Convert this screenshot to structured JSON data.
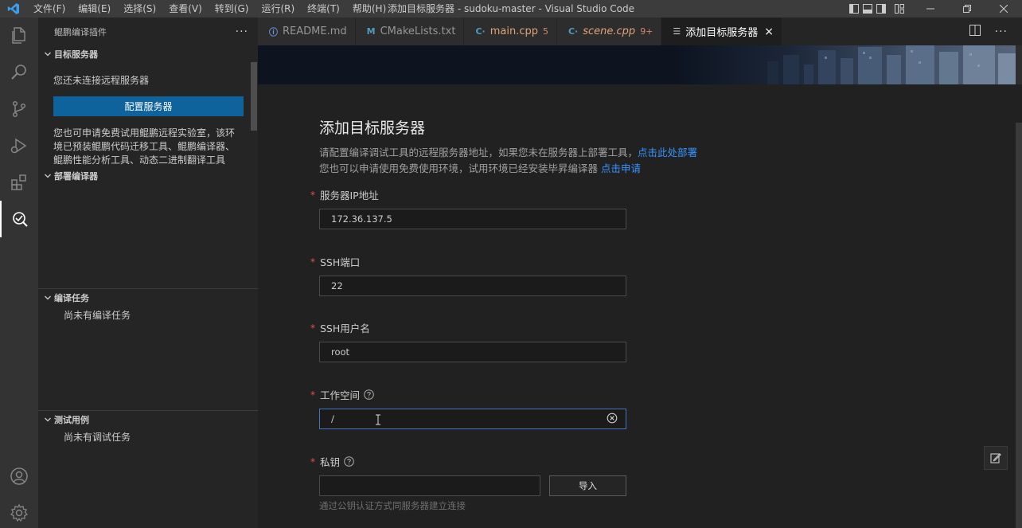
{
  "titlebar": {
    "menu": [
      "文件(F)",
      "编辑(E)",
      "选择(S)",
      "查看(V)",
      "转到(G)",
      "运行(R)",
      "终端(T)",
      "帮助(H)"
    ],
    "window_title": "添加目标服务器 - sudoku-master - Visual Studio Code"
  },
  "activitybar": {
    "icons": [
      "explorer-icon",
      "search-icon",
      "source-control-icon",
      "run-debug-icon",
      "extensions-icon",
      "kunpeng-compiler-icon",
      "account-icon",
      "settings-gear-icon"
    ]
  },
  "sidebar": {
    "title": "鲲鹏编译插件",
    "more": "···",
    "target_server": {
      "header": "目标服务器",
      "status": "您还未连接远程服务器",
      "button": "配置服务器",
      "info_lines": [
        "您也可申请免费试用鲲鹏远程实验室，该环",
        "境已预装鲲鹏代码迁移工具、鲲鹏编译器、",
        "鲲鹏性能分析工具、动态二进制翻译工具"
      ]
    },
    "deploy_compiler": {
      "header": "部署编译器"
    },
    "compile_tasks": {
      "header": "编译任务",
      "empty": "尚未有编译任务"
    },
    "test_cases": {
      "header": "测试用例",
      "empty": "尚未有调试任务"
    }
  },
  "tabs": [
    {
      "label": "README.md",
      "icon": "ⓘ",
      "icon_color": "#6796e6",
      "label_color": "#969696",
      "badge": "",
      "italic": false
    },
    {
      "label": "CMakeLists.txt",
      "icon": "M",
      "icon_color": "#519aba",
      "label_color": "#969696",
      "badge": "",
      "italic": false
    },
    {
      "label": "main.cpp",
      "icon": "C·",
      "icon_color": "#519aba",
      "label_color": "#e2a27a",
      "badge": "5",
      "italic": false
    },
    {
      "label": "scene.cpp",
      "icon": "C·",
      "icon_color": "#519aba",
      "label_color": "#e2a27a",
      "badge": "9+",
      "italic": true
    },
    {
      "label": "添加目标服务器",
      "icon": "☰",
      "icon_color": "#cccccc",
      "label_color": "#ffffff",
      "badge": "",
      "italic": false,
      "active": true,
      "close": "×"
    }
  ],
  "form": {
    "title": "添加目标服务器",
    "desc1": "请配置编译调试工具的远程服务器地址，如果您未在服务器上部署工具，",
    "desc1_link": "点击此处部署",
    "desc2": "您也可以申请使用免费使用环境，试用环境已经安装毕昇编译器 ",
    "desc2_link": "点击申请",
    "required_mark": "*",
    "fields": {
      "ip": {
        "label": "服务器IP地址",
        "value": "172.36.137.5"
      },
      "port": {
        "label": "SSH端口",
        "value": "22"
      },
      "user": {
        "label": "SSH用户名",
        "value": "root"
      },
      "workspace": {
        "label": "工作空间",
        "value": "/"
      },
      "key": {
        "label": "私钥",
        "value": ""
      }
    },
    "import_button": "导入",
    "hint": "通过公钥认证方式同服务器建立连接"
  }
}
